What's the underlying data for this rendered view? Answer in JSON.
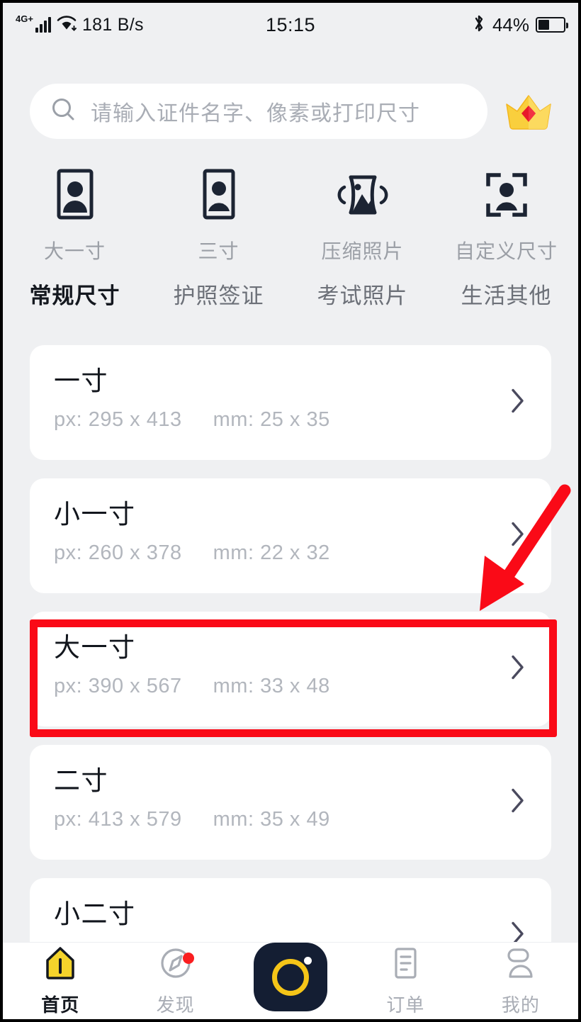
{
  "statusbar": {
    "network_type": "4G+",
    "speed": "181 B/s",
    "time": "15:15",
    "battery_percent": "44%",
    "signal_icon": "signal-bars-icon",
    "wifi_icon": "wifi-icon",
    "bluetooth_icon": "bluetooth-icon",
    "battery_icon": "battery-icon"
  },
  "search": {
    "placeholder": "请输入证件名字、像素或打印尺寸",
    "icon": "search-icon",
    "vip_icon": "crown-icon"
  },
  "quick_actions": [
    {
      "label": "大一寸",
      "icon": "portrait-frame-icon"
    },
    {
      "label": "三寸",
      "icon": "portrait-frame-icon"
    },
    {
      "label": "压缩照片",
      "icon": "compress-image-icon"
    },
    {
      "label": "自定义尺寸",
      "icon": "custom-size-scan-icon"
    }
  ],
  "tabs": [
    {
      "label": "常规尺寸",
      "active": true
    },
    {
      "label": "护照签证",
      "active": false
    },
    {
      "label": "考试照片",
      "active": false
    },
    {
      "label": "生活其他",
      "active": false
    }
  ],
  "size_list": [
    {
      "title": "一寸",
      "px": "px: 295 x 413",
      "mm": "mm: 25 x 35",
      "chevron": "chevron-right-icon"
    },
    {
      "title": "小一寸",
      "px": "px: 260 x 378",
      "mm": "mm: 22 x 32",
      "chevron": "chevron-right-icon"
    },
    {
      "title": "大一寸",
      "px": "px: 390 x 567",
      "mm": "mm: 33 x 48",
      "chevron": "chevron-right-icon"
    },
    {
      "title": "二寸",
      "px": "px: 413 x 579",
      "mm": "mm: 35 x 49",
      "chevron": "chevron-right-icon"
    },
    {
      "title": "小二寸",
      "px": "",
      "mm": "",
      "chevron": "chevron-right-icon"
    }
  ],
  "annotations": {
    "highlight_color": "#fa0a17",
    "arrow_color": "#fa0a17",
    "highlighted_item": "大一寸"
  },
  "bottom_nav": [
    {
      "label": "首页",
      "icon": "home-icon",
      "active": true,
      "badge": false
    },
    {
      "label": "发现",
      "icon": "compass-icon",
      "active": false,
      "badge": true
    },
    {
      "label": "",
      "icon": "camera-button-icon",
      "active": false,
      "badge": false
    },
    {
      "label": "订单",
      "icon": "order-document-icon",
      "active": false,
      "badge": false
    },
    {
      "label": "我的",
      "icon": "person-icon",
      "active": false,
      "badge": false
    }
  ],
  "colors": {
    "page_background": "#eff0f2",
    "card_background": "#ffffff",
    "accent_yellow": "#f5d42b",
    "icon_dark": "#1c2433",
    "camera_navy": "#141e33",
    "annotation_red": "#fa0a17"
  }
}
